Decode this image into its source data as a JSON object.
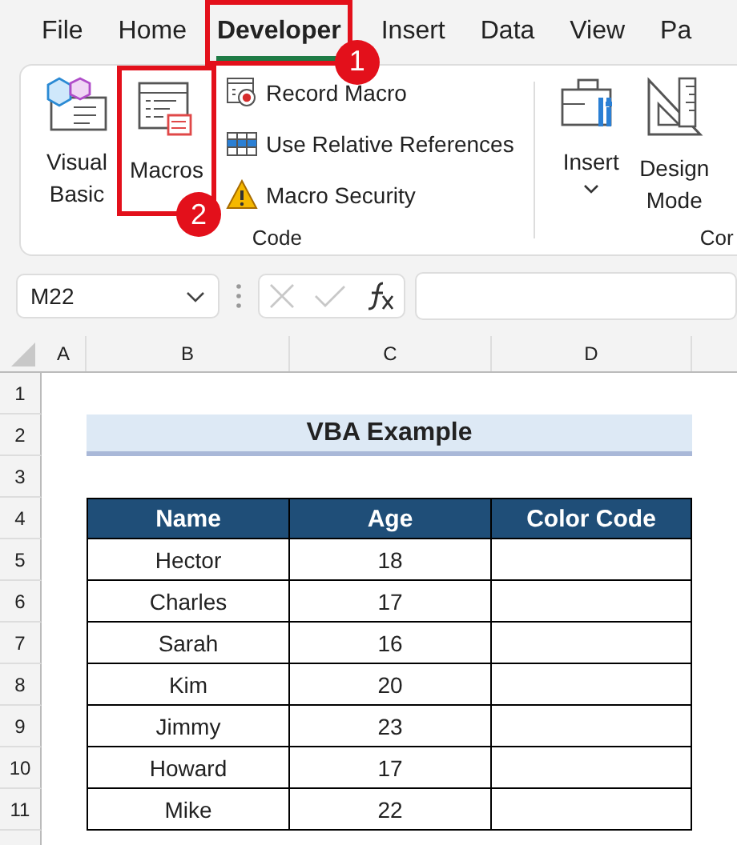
{
  "tabs": [
    {
      "label": "File",
      "selected": false
    },
    {
      "label": "Home",
      "selected": false
    },
    {
      "label": "Developer",
      "selected": true,
      "callout": "1"
    },
    {
      "label": "Insert",
      "selected": false
    },
    {
      "label": "Data",
      "selected": false
    },
    {
      "label": "View",
      "selected": false
    },
    {
      "label": "Pa",
      "selected": false
    }
  ],
  "code_group": {
    "label": "Code",
    "visual_basic": "Visual Basic",
    "macros": {
      "label": "Macros",
      "callout": "2"
    },
    "small_buttons": [
      {
        "label": "Record Macro",
        "kind": "record"
      },
      {
        "label": "Use Relative References",
        "kind": "relative"
      },
      {
        "label": "Macro Security",
        "kind": "security"
      }
    ]
  },
  "controls_group": {
    "label": "Cor",
    "insert": {
      "label": "Insert",
      "dropdown": true
    },
    "design_mode": "Design Mode"
  },
  "name_box": "M22",
  "columns": [
    "A",
    "B",
    "C",
    "D"
  ],
  "row_numbers": [
    "1",
    "2",
    "3",
    "4",
    "5",
    "6",
    "7",
    "8",
    "9",
    "10",
    "11"
  ],
  "title": "VBA Example",
  "table": {
    "columns": [
      "Name",
      "Age",
      "Color Code"
    ],
    "rows": [
      {
        "name": "Hector",
        "age": "18"
      },
      {
        "name": "Charles",
        "age": "17"
      },
      {
        "name": "Sarah",
        "age": "16"
      },
      {
        "name": "Kim",
        "age": "20"
      },
      {
        "name": "Jimmy",
        "age": "23"
      },
      {
        "name": "Howard",
        "age": "17"
      },
      {
        "name": "Mike",
        "age": "22"
      }
    ]
  }
}
